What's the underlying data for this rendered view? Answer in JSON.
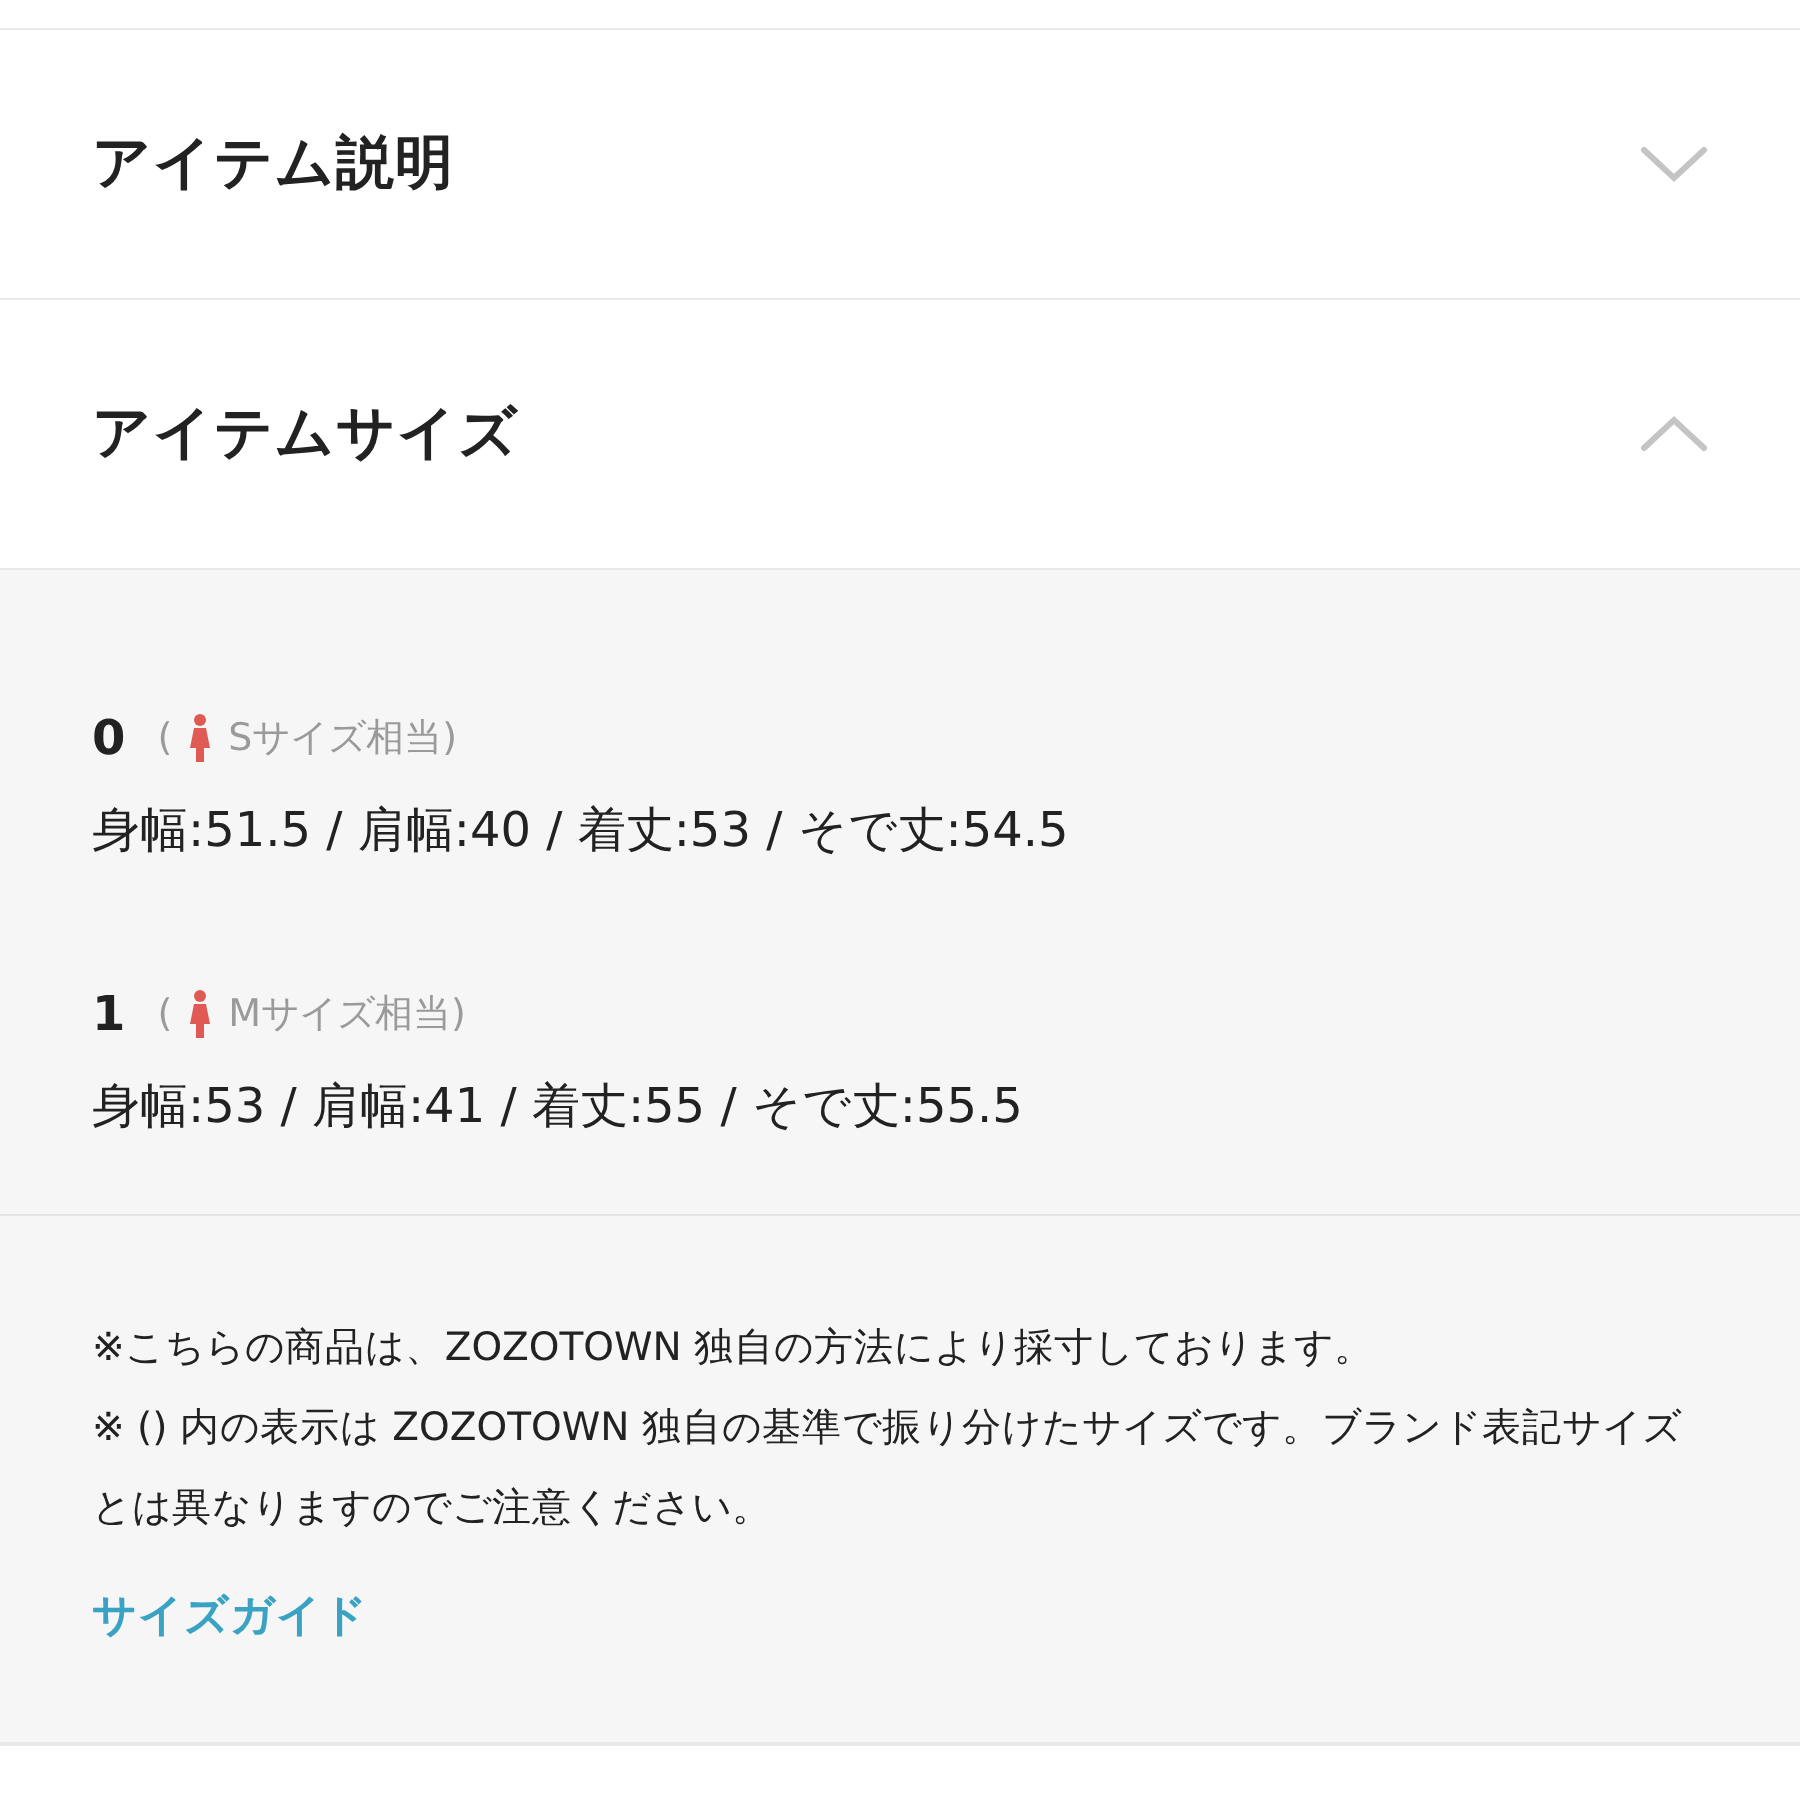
{
  "sections": [
    {
      "title": "アイテム説明",
      "expanded": false
    },
    {
      "title": "アイテムサイズ",
      "expanded": true,
      "sizes": [
        {
          "label": "0",
          "hint_open": "(",
          "hint": "Sサイズ相当)",
          "measurements": "身幅:51.5 / 肩幅:40 / 着丈:53 / そで丈:54.5"
        },
        {
          "label": "1",
          "hint_open": "(",
          "hint": "Mサイズ相当)",
          "measurements": "身幅:53 / 肩幅:41 / 着丈:55 / そで丈:55.5"
        }
      ],
      "notes": [
        "※こちらの商品は、ZOZOTOWN 独自の方法により採寸しております。",
        "※ () 内の表示は ZOZOTOWN 独自の基準で振り分けたサイズです。ブランド表記サイズとは異なりますのでご注意ください。"
      ],
      "link": "サイズガイド"
    }
  ]
}
